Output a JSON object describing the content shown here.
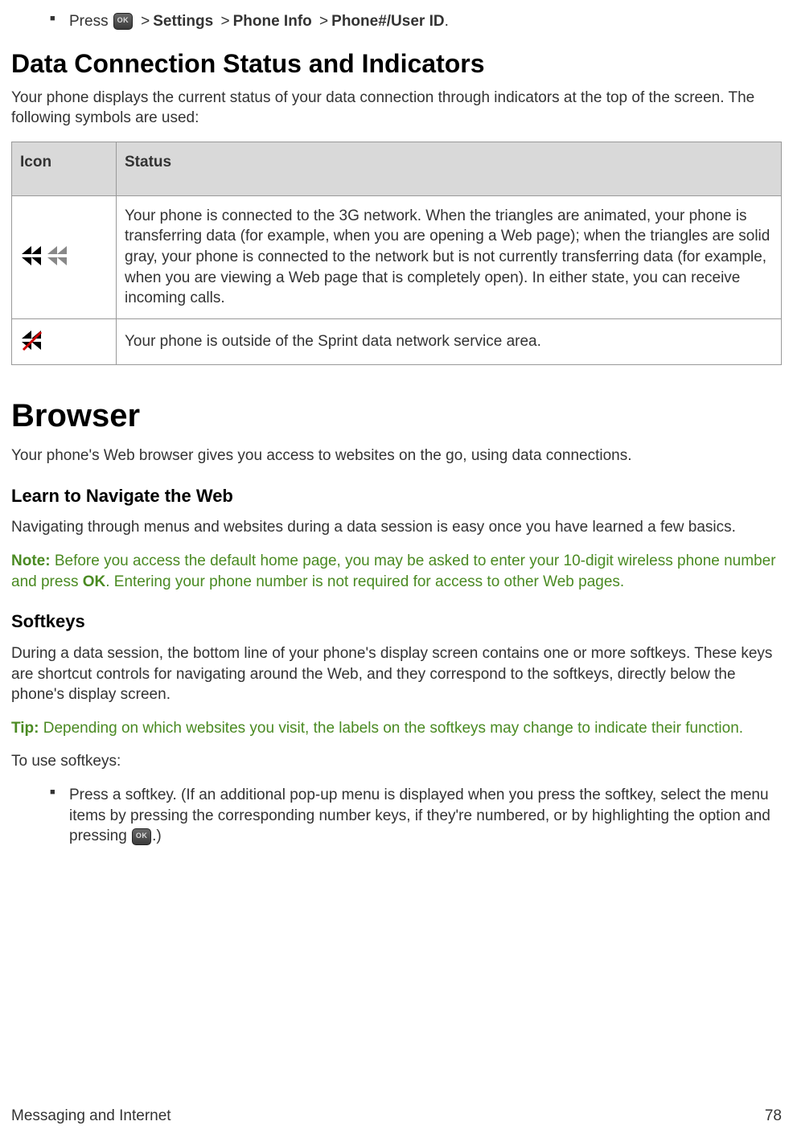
{
  "intro": {
    "press_word": "Press ",
    "nav_parts": [
      "Settings",
      "Phone Info",
      "Phone#/User ID"
    ],
    "period": "."
  },
  "section1": {
    "heading": "Data Connection Status and Indicators",
    "para": "Your phone displays the current status of your data connection through indicators at the top of the screen. The following symbols are used:"
  },
  "table": {
    "h_icon": "Icon",
    "h_status": "Status",
    "row1_status": "Your phone is connected to the 3G network. When the triangles are animated, your phone is transferring data (for example, when you are opening a Web page); when the triangles are solid gray, your phone is connected to the network but is not currently transferring data (for example, when you are viewing a Web page that is completely open). In either state, you can receive incoming calls.",
    "row2_status": "Your phone is outside of the Sprint data network service area."
  },
  "browser": {
    "heading": "Browser",
    "para": "Your phone's Web browser gives you access to websites on the go, using data connections."
  },
  "learn": {
    "heading": "Learn to Navigate the Web",
    "para": "Navigating through menus and websites during a data session is easy once you have learned a few basics."
  },
  "note": {
    "label": "Note:",
    "text_before_ok": " Before you access the default home page, you may be asked to enter your 10-digit wireless phone number and press ",
    "ok_word": "OK",
    "text_after_ok": ". Entering your phone number is not required for access to other Web pages."
  },
  "softkeys": {
    "heading": "Softkeys",
    "para": "During a data session, the bottom line of your phone's display screen contains one or more softkeys. These keys are shortcut controls for navigating around the Web, and they correspond to the softkeys, directly below the phone's display screen."
  },
  "tip": {
    "label": "Tip:",
    "text": " Depending on which websites you visit, the labels on the softkeys may change to indicate their function."
  },
  "use_softkeys": {
    "lead": "To use softkeys:",
    "bullet_before": "Press a softkey. (If an additional pop-up menu is displayed when you press the softkey, select the menu items by pressing the corresponding number keys, if they're numbered, or by highlighting the option and pressing ",
    "bullet_after": ".)"
  },
  "footer": {
    "left": "Messaging and Internet",
    "right": "78"
  }
}
